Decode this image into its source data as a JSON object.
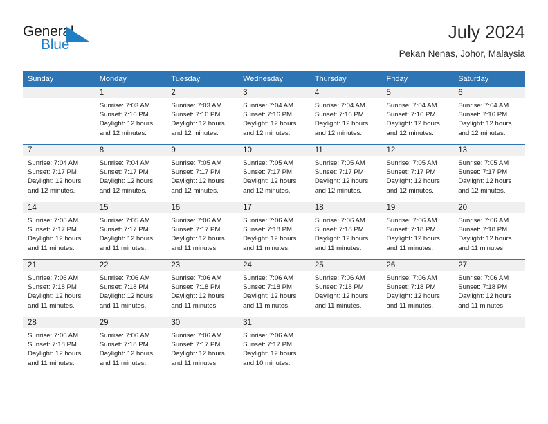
{
  "brand": {
    "name_top": "General",
    "name_bottom": "Blue",
    "triangle_icon": "triangle-icon",
    "colors": {
      "dark": "#1d1d1d",
      "blue": "#1f7fc4"
    }
  },
  "header": {
    "title": "July 2024",
    "subtitle": "Pekan Nenas, Johor, Malaysia"
  },
  "theme": {
    "header_blue": "#2e75b6",
    "daynum_gray": "#f0f0f0",
    "text": "#1a1a1a"
  },
  "weekday_headers": [
    "Sunday",
    "Monday",
    "Tuesday",
    "Wednesday",
    "Thursday",
    "Friday",
    "Saturday"
  ],
  "weeks": [
    [
      {
        "day": "",
        "sunrise": "",
        "sunset": "",
        "daylight_line1": "",
        "daylight_line2": ""
      },
      {
        "day": "1",
        "sunrise": "Sunrise: 7:03 AM",
        "sunset": "Sunset: 7:16 PM",
        "daylight_line1": "Daylight: 12 hours",
        "daylight_line2": "and 12 minutes."
      },
      {
        "day": "2",
        "sunrise": "Sunrise: 7:03 AM",
        "sunset": "Sunset: 7:16 PM",
        "daylight_line1": "Daylight: 12 hours",
        "daylight_line2": "and 12 minutes."
      },
      {
        "day": "3",
        "sunrise": "Sunrise: 7:04 AM",
        "sunset": "Sunset: 7:16 PM",
        "daylight_line1": "Daylight: 12 hours",
        "daylight_line2": "and 12 minutes."
      },
      {
        "day": "4",
        "sunrise": "Sunrise: 7:04 AM",
        "sunset": "Sunset: 7:16 PM",
        "daylight_line1": "Daylight: 12 hours",
        "daylight_line2": "and 12 minutes."
      },
      {
        "day": "5",
        "sunrise": "Sunrise: 7:04 AM",
        "sunset": "Sunset: 7:16 PM",
        "daylight_line1": "Daylight: 12 hours",
        "daylight_line2": "and 12 minutes."
      },
      {
        "day": "6",
        "sunrise": "Sunrise: 7:04 AM",
        "sunset": "Sunset: 7:16 PM",
        "daylight_line1": "Daylight: 12 hours",
        "daylight_line2": "and 12 minutes."
      }
    ],
    [
      {
        "day": "7",
        "sunrise": "Sunrise: 7:04 AM",
        "sunset": "Sunset: 7:17 PM",
        "daylight_line1": "Daylight: 12 hours",
        "daylight_line2": "and 12 minutes."
      },
      {
        "day": "8",
        "sunrise": "Sunrise: 7:04 AM",
        "sunset": "Sunset: 7:17 PM",
        "daylight_line1": "Daylight: 12 hours",
        "daylight_line2": "and 12 minutes."
      },
      {
        "day": "9",
        "sunrise": "Sunrise: 7:05 AM",
        "sunset": "Sunset: 7:17 PM",
        "daylight_line1": "Daylight: 12 hours",
        "daylight_line2": "and 12 minutes."
      },
      {
        "day": "10",
        "sunrise": "Sunrise: 7:05 AM",
        "sunset": "Sunset: 7:17 PM",
        "daylight_line1": "Daylight: 12 hours",
        "daylight_line2": "and 12 minutes."
      },
      {
        "day": "11",
        "sunrise": "Sunrise: 7:05 AM",
        "sunset": "Sunset: 7:17 PM",
        "daylight_line1": "Daylight: 12 hours",
        "daylight_line2": "and 12 minutes."
      },
      {
        "day": "12",
        "sunrise": "Sunrise: 7:05 AM",
        "sunset": "Sunset: 7:17 PM",
        "daylight_line1": "Daylight: 12 hours",
        "daylight_line2": "and 12 minutes."
      },
      {
        "day": "13",
        "sunrise": "Sunrise: 7:05 AM",
        "sunset": "Sunset: 7:17 PM",
        "daylight_line1": "Daylight: 12 hours",
        "daylight_line2": "and 12 minutes."
      }
    ],
    [
      {
        "day": "14",
        "sunrise": "Sunrise: 7:05 AM",
        "sunset": "Sunset: 7:17 PM",
        "daylight_line1": "Daylight: 12 hours",
        "daylight_line2": "and 11 minutes."
      },
      {
        "day": "15",
        "sunrise": "Sunrise: 7:05 AM",
        "sunset": "Sunset: 7:17 PM",
        "daylight_line1": "Daylight: 12 hours",
        "daylight_line2": "and 11 minutes."
      },
      {
        "day": "16",
        "sunrise": "Sunrise: 7:06 AM",
        "sunset": "Sunset: 7:17 PM",
        "daylight_line1": "Daylight: 12 hours",
        "daylight_line2": "and 11 minutes."
      },
      {
        "day": "17",
        "sunrise": "Sunrise: 7:06 AM",
        "sunset": "Sunset: 7:18 PM",
        "daylight_line1": "Daylight: 12 hours",
        "daylight_line2": "and 11 minutes."
      },
      {
        "day": "18",
        "sunrise": "Sunrise: 7:06 AM",
        "sunset": "Sunset: 7:18 PM",
        "daylight_line1": "Daylight: 12 hours",
        "daylight_line2": "and 11 minutes."
      },
      {
        "day": "19",
        "sunrise": "Sunrise: 7:06 AM",
        "sunset": "Sunset: 7:18 PM",
        "daylight_line1": "Daylight: 12 hours",
        "daylight_line2": "and 11 minutes."
      },
      {
        "day": "20",
        "sunrise": "Sunrise: 7:06 AM",
        "sunset": "Sunset: 7:18 PM",
        "daylight_line1": "Daylight: 12 hours",
        "daylight_line2": "and 11 minutes."
      }
    ],
    [
      {
        "day": "21",
        "sunrise": "Sunrise: 7:06 AM",
        "sunset": "Sunset: 7:18 PM",
        "daylight_line1": "Daylight: 12 hours",
        "daylight_line2": "and 11 minutes."
      },
      {
        "day": "22",
        "sunrise": "Sunrise: 7:06 AM",
        "sunset": "Sunset: 7:18 PM",
        "daylight_line1": "Daylight: 12 hours",
        "daylight_line2": "and 11 minutes."
      },
      {
        "day": "23",
        "sunrise": "Sunrise: 7:06 AM",
        "sunset": "Sunset: 7:18 PM",
        "daylight_line1": "Daylight: 12 hours",
        "daylight_line2": "and 11 minutes."
      },
      {
        "day": "24",
        "sunrise": "Sunrise: 7:06 AM",
        "sunset": "Sunset: 7:18 PM",
        "daylight_line1": "Daylight: 12 hours",
        "daylight_line2": "and 11 minutes."
      },
      {
        "day": "25",
        "sunrise": "Sunrise: 7:06 AM",
        "sunset": "Sunset: 7:18 PM",
        "daylight_line1": "Daylight: 12 hours",
        "daylight_line2": "and 11 minutes."
      },
      {
        "day": "26",
        "sunrise": "Sunrise: 7:06 AM",
        "sunset": "Sunset: 7:18 PM",
        "daylight_line1": "Daylight: 12 hours",
        "daylight_line2": "and 11 minutes."
      },
      {
        "day": "27",
        "sunrise": "Sunrise: 7:06 AM",
        "sunset": "Sunset: 7:18 PM",
        "daylight_line1": "Daylight: 12 hours",
        "daylight_line2": "and 11 minutes."
      }
    ],
    [
      {
        "day": "28",
        "sunrise": "Sunrise: 7:06 AM",
        "sunset": "Sunset: 7:18 PM",
        "daylight_line1": "Daylight: 12 hours",
        "daylight_line2": "and 11 minutes."
      },
      {
        "day": "29",
        "sunrise": "Sunrise: 7:06 AM",
        "sunset": "Sunset: 7:18 PM",
        "daylight_line1": "Daylight: 12 hours",
        "daylight_line2": "and 11 minutes."
      },
      {
        "day": "30",
        "sunrise": "Sunrise: 7:06 AM",
        "sunset": "Sunset: 7:17 PM",
        "daylight_line1": "Daylight: 12 hours",
        "daylight_line2": "and 11 minutes."
      },
      {
        "day": "31",
        "sunrise": "Sunrise: 7:06 AM",
        "sunset": "Sunset: 7:17 PM",
        "daylight_line1": "Daylight: 12 hours",
        "daylight_line2": "and 10 minutes."
      },
      {
        "day": "",
        "sunrise": "",
        "sunset": "",
        "daylight_line1": "",
        "daylight_line2": ""
      },
      {
        "day": "",
        "sunrise": "",
        "sunset": "",
        "daylight_line1": "",
        "daylight_line2": ""
      },
      {
        "day": "",
        "sunrise": "",
        "sunset": "",
        "daylight_line1": "",
        "daylight_line2": ""
      }
    ]
  ]
}
